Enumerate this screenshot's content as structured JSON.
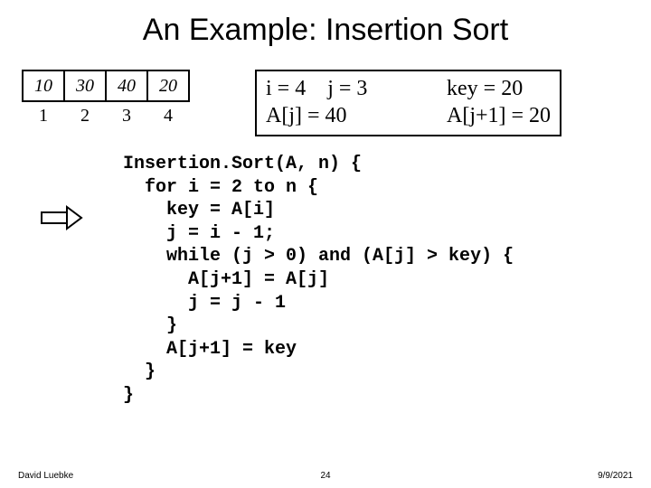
{
  "title": "An Example: Insertion Sort",
  "array": [
    "10",
    "30",
    "40",
    "20"
  ],
  "indices": [
    "1",
    "2",
    "3",
    "4"
  ],
  "state": {
    "l1a": "i = 4",
    "l1b": "j = 3",
    "l1c": "key = 20",
    "l2a": "A[j] = 40",
    "l2c": "A[j+1] = 20"
  },
  "code": "Insertion.Sort(A, n) {\n  for i = 2 to n {\n    key = A[i]\n    j = i - 1;\n    while (j > 0) and (A[j] > key) {\n      A[j+1] = A[j]\n      j = j - 1\n    }\n    A[j+1] = key\n  }\n}",
  "footer": {
    "author": "David Luebke",
    "page": "24",
    "date": "9/9/2021"
  }
}
